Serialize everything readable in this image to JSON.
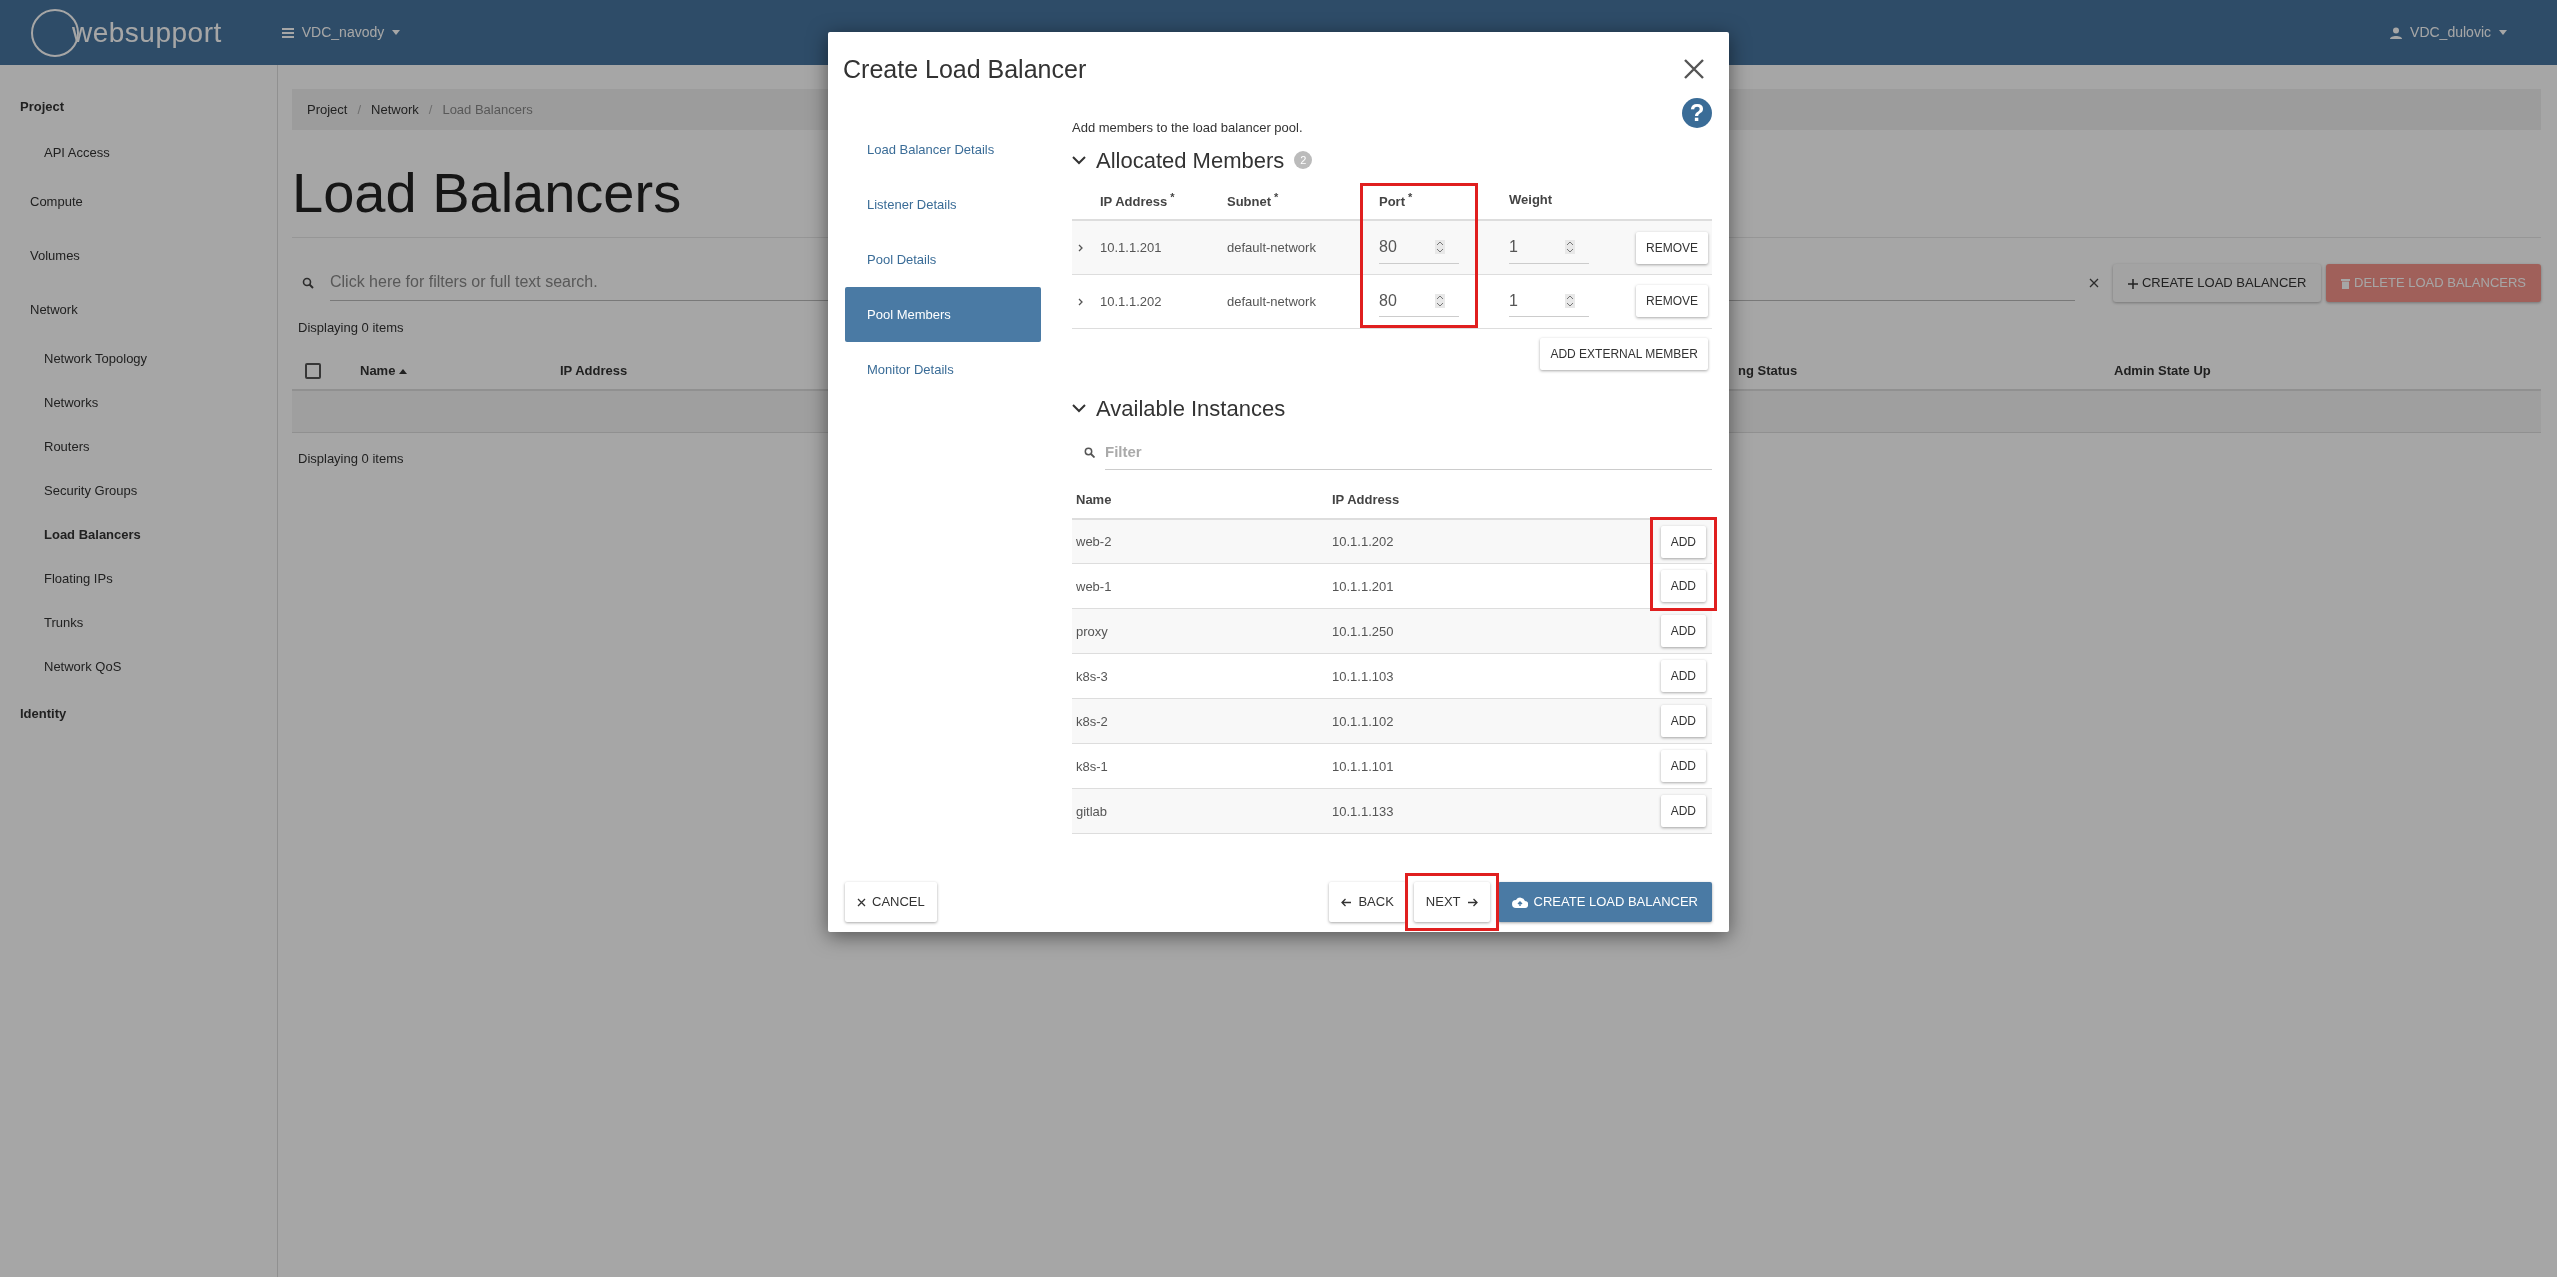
{
  "topbar": {
    "logo": "websupport",
    "project": "VDC_navody",
    "user": "VDC_dulovic"
  },
  "sidebar": {
    "groups": [
      {
        "label": "Project",
        "items": [
          {
            "label": "API Access",
            "kind": "sub",
            "selected": false
          },
          {
            "label": "Compute",
            "kind": "section",
            "selected": false
          },
          {
            "label": "Volumes",
            "kind": "section",
            "selected": false
          },
          {
            "label": "Network",
            "kind": "section",
            "selected": false
          },
          {
            "label": "Network Topology",
            "kind": "sub",
            "selected": false
          },
          {
            "label": "Networks",
            "kind": "sub",
            "selected": false
          },
          {
            "label": "Routers",
            "kind": "sub",
            "selected": false
          },
          {
            "label": "Security Groups",
            "kind": "sub",
            "selected": false
          },
          {
            "label": "Load Balancers",
            "kind": "sub",
            "selected": true
          },
          {
            "label": "Floating IPs",
            "kind": "sub",
            "selected": false
          },
          {
            "label": "Trunks",
            "kind": "sub",
            "selected": false
          },
          {
            "label": "Network QoS",
            "kind": "sub",
            "selected": false
          }
        ]
      },
      {
        "label": "Identity"
      }
    ]
  },
  "page": {
    "breadcrumb": [
      {
        "label": "Project",
        "separator": "/"
      },
      {
        "label": "Network",
        "separator": "/"
      },
      {
        "label": "Load Balancers"
      }
    ],
    "title": "Load Balancers",
    "search": {
      "placeholder": "Click here for filters or full text search."
    },
    "buttons": [
      {
        "label": "CREATE LOAD BALANCER",
        "kind": "create"
      },
      {
        "label": "DELETE LOAD BALANCERS",
        "kind": "delete"
      }
    ],
    "count_top": "Displaying 0 items",
    "count_bottom": "Displaying 0 items",
    "table": {
      "select_all": {
        "checked": false
      },
      "columns": [
        "Name",
        "IP Address",
        "ng Status",
        "Admin State Up"
      ]
    }
  },
  "modal": {
    "title": "Create Load Balancer",
    "help": "?",
    "steps": [
      {
        "label": "Load Balancer Details",
        "selected": false
      },
      {
        "label": "Listener Details",
        "selected": false
      },
      {
        "label": "Pool Details",
        "selected": false
      },
      {
        "label": "Pool Members",
        "selected": true
      },
      {
        "label": "Monitor Details",
        "selected": false
      }
    ],
    "intro": "Add members to the load balancer pool.",
    "allocated": {
      "title": "Allocated Members",
      "count": "2",
      "expanded": true,
      "columns": [
        {
          "label": "IP Address",
          "required_mark": "*",
          "highlighted": false
        },
        {
          "label": "Subnet",
          "required_mark": "*",
          "highlighted": false
        },
        {
          "label": "Port",
          "required_mark": "*",
          "highlighted": true
        },
        {
          "label": "Weight",
          "highlighted": false
        }
      ],
      "rows": [
        {
          "ip": "10.1.1.201",
          "subnet": "default-network",
          "port": "80",
          "weight": "1",
          "action": "REMOVE"
        },
        {
          "ip": "10.1.1.202",
          "subnet": "default-network",
          "port": "80",
          "weight": "1",
          "action": "REMOVE"
        }
      ],
      "add_external": "ADD EXTERNAL MEMBER"
    },
    "available": {
      "title": "Available Instances",
      "expanded": true,
      "filter_placeholder": "Filter",
      "columns": [
        "Name",
        "IP Address"
      ],
      "rows": [
        {
          "name": "web-2",
          "ip": "10.1.1.202",
          "action": "ADD",
          "highlighted": true
        },
        {
          "name": "web-1",
          "ip": "10.1.1.201",
          "action": "ADD",
          "highlighted": true
        },
        {
          "name": "proxy",
          "ip": "10.1.1.250",
          "action": "ADD",
          "highlighted": false
        },
        {
          "name": "k8s-3",
          "ip": "10.1.1.103",
          "action": "ADD",
          "highlighted": false
        },
        {
          "name": "k8s-2",
          "ip": "10.1.1.102",
          "action": "ADD",
          "highlighted": false
        },
        {
          "name": "k8s-1",
          "ip": "10.1.1.101",
          "action": "ADD",
          "highlighted": false
        },
        {
          "name": "gitlab",
          "ip": "10.1.1.133",
          "action": "ADD",
          "highlighted": false
        }
      ]
    },
    "footer": [
      {
        "label": "CANCEL",
        "kind": "cancel",
        "highlighted": false
      },
      {
        "label": "BACK",
        "kind": "back",
        "highlighted": false
      },
      {
        "label": "NEXT",
        "kind": "next",
        "highlighted": true
      },
      {
        "label": "CREATE LOAD BALANCER",
        "kind": "create",
        "highlighted": false
      }
    ]
  }
}
